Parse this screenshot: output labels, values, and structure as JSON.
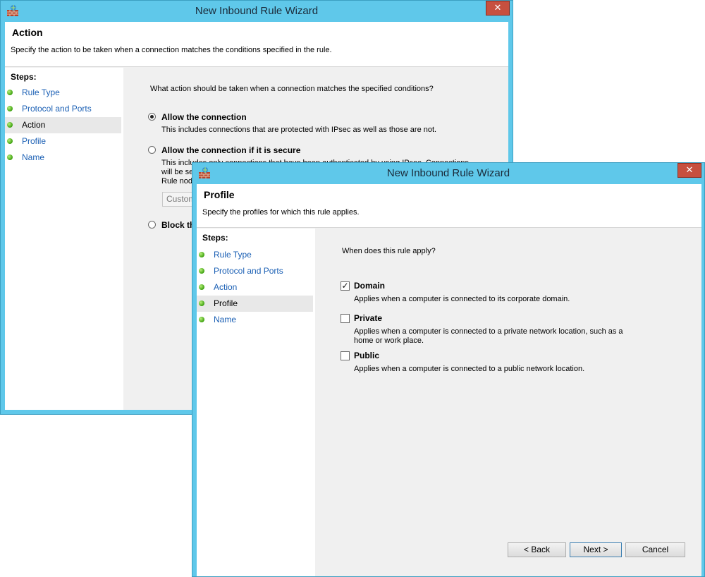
{
  "back_window": {
    "title": "New Inbound Rule Wizard",
    "close_glyph": "✕",
    "header": {
      "title": "Action",
      "description": "Specify the action to be taken when a connection matches the conditions specified in the rule."
    },
    "steps_title": "Steps:",
    "steps": [
      "Rule Type",
      "Protocol and Ports",
      "Action",
      "Profile",
      "Name"
    ],
    "current_step": "Action",
    "question": "What action should be taken when a connection matches the specified conditions?",
    "options": [
      {
        "label": "Allow the connection",
        "description": "This includes connections that are protected with IPsec as well as those are not.",
        "selected": true
      },
      {
        "label": "Allow the connection if it is secure",
        "description": "This includes only connections that have been authenticated by using IPsec. Connections will be secured using the settings in IPsec properties and rules in the Connection Security Rule node.",
        "selected": false
      },
      {
        "label": "Block the connection",
        "description": "",
        "selected": false
      }
    ],
    "customize_button": "Customize..."
  },
  "front_window": {
    "title": "New Inbound Rule Wizard",
    "close_glyph": "✕",
    "header": {
      "title": "Profile",
      "description": "Specify the profiles for which this rule applies."
    },
    "steps_title": "Steps:",
    "steps": [
      "Rule Type",
      "Protocol and Ports",
      "Action",
      "Profile",
      "Name"
    ],
    "current_step": "Profile",
    "question": "When does this rule apply?",
    "profiles": [
      {
        "label": "Domain",
        "description": "Applies when a computer is connected to its corporate domain.",
        "checked": true
      },
      {
        "label": "Private",
        "description": "Applies when a computer is connected to a private network location, such as a home or work place.",
        "checked": false
      },
      {
        "label": "Public",
        "description": "Applies when a computer is connected to a public network location.",
        "checked": false
      }
    ],
    "buttons": {
      "back": "< Back",
      "next": "Next >",
      "cancel": "Cancel"
    }
  },
  "icons": {
    "app": "firewall-icon",
    "close": "close-icon",
    "step": "green-dot-icon"
  }
}
